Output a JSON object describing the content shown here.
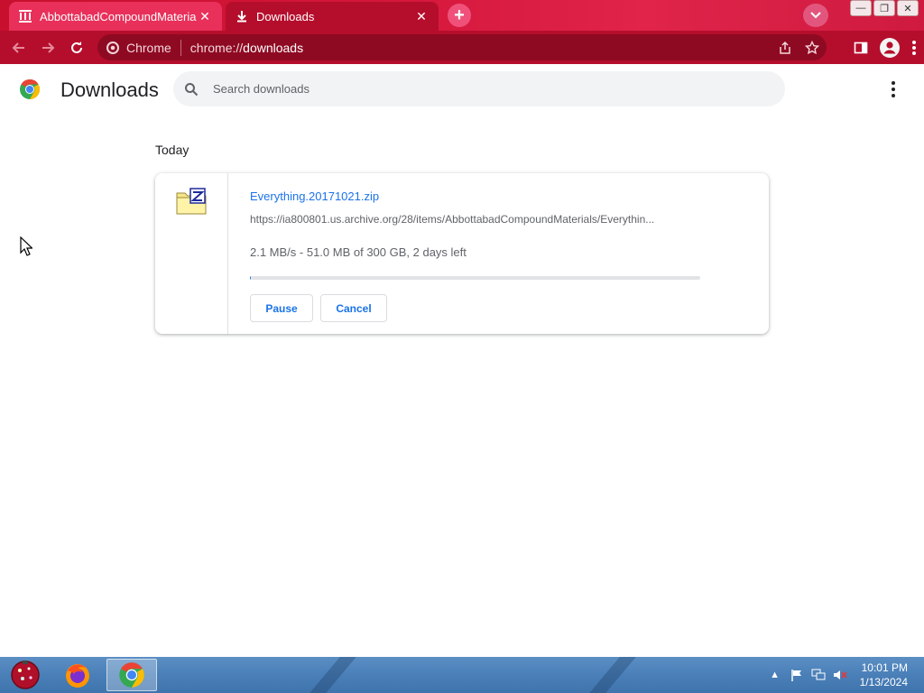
{
  "tabs": [
    {
      "title": "AbbottabadCompoundMaterials",
      "icon": "archive-icon",
      "active": false
    },
    {
      "title": "Downloads",
      "icon": "download-icon",
      "active": true
    }
  ],
  "omnibox": {
    "site_label": "Chrome",
    "url_prefix": "chrome://",
    "url_host": "downloads"
  },
  "page": {
    "title": "Downloads",
    "search_placeholder": "Search downloads"
  },
  "downloads": {
    "section": "Today",
    "items": [
      {
        "filename": "Everything.20171021.zip",
        "url": "https://ia800801.us.archive.org/28/items/AbbottabadCompoundMaterials/Everythin...",
        "status": "2.1 MB/s - 51.0 MB of 300 GB, 2 days left",
        "progress": 0.0002,
        "pause_label": "Pause",
        "cancel_label": "Cancel"
      }
    ]
  },
  "taskbar": {
    "time": "10:01 PM",
    "date": "1/13/2024"
  },
  "colors": {
    "frame": "#c8102e",
    "accent": "#1a73e8"
  }
}
